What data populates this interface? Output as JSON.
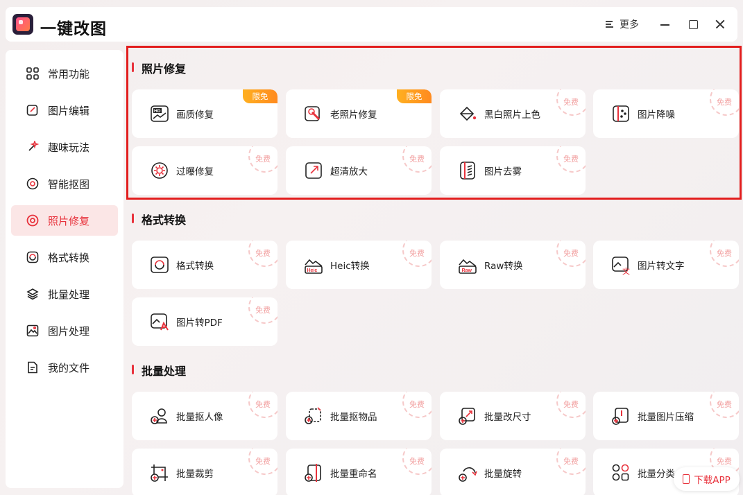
{
  "app": {
    "title": "一键改图",
    "more_label": "更多",
    "download_label": "下载APP"
  },
  "sidebar": {
    "items": [
      {
        "label": "常用功能",
        "icon": "grid-icon",
        "active": false
      },
      {
        "label": "图片编辑",
        "icon": "edit-icon",
        "active": false
      },
      {
        "label": "趣味玩法",
        "icon": "sparkle-icon",
        "active": false
      },
      {
        "label": "智能抠图",
        "icon": "target-icon",
        "active": false
      },
      {
        "label": "照片修复",
        "icon": "repair-icon",
        "active": true
      },
      {
        "label": "格式转换",
        "icon": "convert-icon",
        "active": false
      },
      {
        "label": "批量处理",
        "icon": "layers-icon",
        "active": false
      },
      {
        "label": "图片处理",
        "icon": "image-icon",
        "active": false
      },
      {
        "label": "我的文件",
        "icon": "file-icon",
        "active": false
      }
    ]
  },
  "sections": [
    {
      "title": "照片修复",
      "cards": [
        {
          "label": "画质修复",
          "badge": "限免",
          "badge_type": "limit",
          "icon": "hd-icon"
        },
        {
          "label": "老照片修复",
          "badge": "限免",
          "badge_type": "limit",
          "icon": "wrench-photo-icon"
        },
        {
          "label": "黑白照片上色",
          "badge": "免费",
          "badge_type": "free",
          "icon": "paint-bucket-icon"
        },
        {
          "label": "图片降噪",
          "badge": "免费",
          "badge_type": "free",
          "icon": "denoise-icon"
        },
        {
          "label": "过曝修复",
          "badge": "免费",
          "badge_type": "free",
          "icon": "exposure-icon"
        },
        {
          "label": "超清放大",
          "badge": "免费",
          "badge_type": "free",
          "icon": "enlarge-icon"
        },
        {
          "label": "图片去雾",
          "badge": "免费",
          "badge_type": "free",
          "icon": "dehaze-icon"
        }
      ]
    },
    {
      "title": "格式转换",
      "cards": [
        {
          "label": "格式转换",
          "badge": "免费",
          "badge_type": "free",
          "icon": "format-convert-icon"
        },
        {
          "label": "Heic转换",
          "badge": "免费",
          "badge_type": "free",
          "icon": "heic-icon",
          "tag": "Heic"
        },
        {
          "label": "Raw转换",
          "badge": "免费",
          "badge_type": "free",
          "icon": "raw-icon",
          "tag": "Raw"
        },
        {
          "label": "图片转文字",
          "badge": "免费",
          "badge_type": "free",
          "icon": "image-to-text-icon"
        },
        {
          "label": "图片转PDF",
          "badge": "免费",
          "badge_type": "free",
          "icon": "image-to-pdf-icon"
        }
      ]
    },
    {
      "title": "批量处理",
      "cards": [
        {
          "label": "批量抠人像",
          "badge": "免费",
          "badge_type": "free",
          "icon": "batch-portrait-icon"
        },
        {
          "label": "批量抠物品",
          "badge": "免费",
          "badge_type": "free",
          "icon": "batch-object-icon"
        },
        {
          "label": "批量改尺寸",
          "badge": "免费",
          "badge_type": "free",
          "icon": "batch-resize-icon"
        },
        {
          "label": "批量图片压缩",
          "badge": "免费",
          "badge_type": "free",
          "icon": "batch-compress-icon"
        },
        {
          "label": "批量裁剪",
          "badge": "免费",
          "badge_type": "free",
          "icon": "batch-crop-icon"
        },
        {
          "label": "批量重命名",
          "badge": "免费",
          "badge_type": "free",
          "icon": "batch-rename-icon"
        },
        {
          "label": "批量旋转",
          "badge": "免费",
          "badge_type": "free",
          "icon": "batch-rotate-icon"
        },
        {
          "label": "批量分类",
          "badge": "免费",
          "badge_type": "free",
          "icon": "batch-classify-icon"
        }
      ]
    }
  ],
  "colors": {
    "accent": "#e8323c",
    "highlight_border": "#e21d1d",
    "limit_badge": "#ff9a1f",
    "free_badge": "#f2a0a0"
  }
}
